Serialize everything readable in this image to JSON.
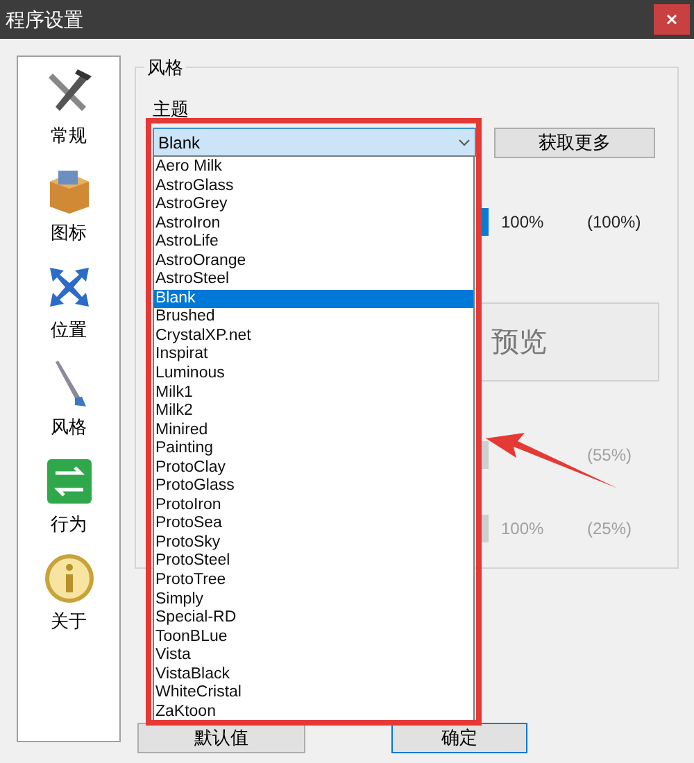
{
  "window": {
    "title": "程序设置"
  },
  "sidebar": {
    "items": [
      {
        "label": "常规",
        "kind": "tools"
      },
      {
        "label": "图标",
        "kind": "box"
      },
      {
        "label": "位置",
        "kind": "move"
      },
      {
        "label": "风格",
        "kind": "brush"
      },
      {
        "label": "行为",
        "kind": "swap"
      },
      {
        "label": "关于",
        "kind": "info"
      }
    ]
  },
  "style_group": {
    "title": "风格",
    "theme_label": "主题",
    "theme_value": "Blank",
    "get_more_button": "获取更多",
    "preview": "预览",
    "rows": [
      {
        "value": "100%",
        "percent": "(100%)",
        "disabled": false
      },
      {
        "percent": "(55%)",
        "disabled": true
      },
      {
        "value": "100%",
        "percent": "(25%)",
        "disabled": true
      }
    ]
  },
  "dropdown": {
    "items": [
      {
        "label": "Aero Milk",
        "selected": false
      },
      {
        "label": "AstroGlass",
        "selected": false
      },
      {
        "label": "AstroGrey",
        "selected": false
      },
      {
        "label": "AstroIron",
        "selected": false
      },
      {
        "label": "AstroLife",
        "selected": false
      },
      {
        "label": "AstroOrange",
        "selected": false
      },
      {
        "label": "AstroSteel",
        "selected": false
      },
      {
        "label": "Blank",
        "selected": true
      },
      {
        "label": "Brushed",
        "selected": false
      },
      {
        "label": "CrystalXP.net",
        "selected": false
      },
      {
        "label": "Inspirat",
        "selected": false
      },
      {
        "label": "Luminous",
        "selected": false
      },
      {
        "label": "Milk1",
        "selected": false
      },
      {
        "label": "Milk2",
        "selected": false
      },
      {
        "label": "Minired",
        "selected": false
      },
      {
        "label": "Painting",
        "selected": false
      },
      {
        "label": "ProtoClay",
        "selected": false
      },
      {
        "label": "ProtoGlass",
        "selected": false
      },
      {
        "label": "ProtoIron",
        "selected": false
      },
      {
        "label": "ProtoSea",
        "selected": false
      },
      {
        "label": "ProtoSky",
        "selected": false
      },
      {
        "label": "ProtoSteel",
        "selected": false
      },
      {
        "label": "ProtoTree",
        "selected": false
      },
      {
        "label": "Simply",
        "selected": false
      },
      {
        "label": "Special-RD",
        "selected": false
      },
      {
        "label": "ToonBLue",
        "selected": false
      },
      {
        "label": "Vista",
        "selected": false
      },
      {
        "label": "VistaBlack",
        "selected": false
      },
      {
        "label": "WhiteCristal",
        "selected": false
      },
      {
        "label": "ZaKtoon",
        "selected": false
      }
    ]
  },
  "buttons": [
    {
      "label": "默认值",
      "kind": "default"
    },
    {
      "label": "确定",
      "kind": "primary"
    }
  ]
}
